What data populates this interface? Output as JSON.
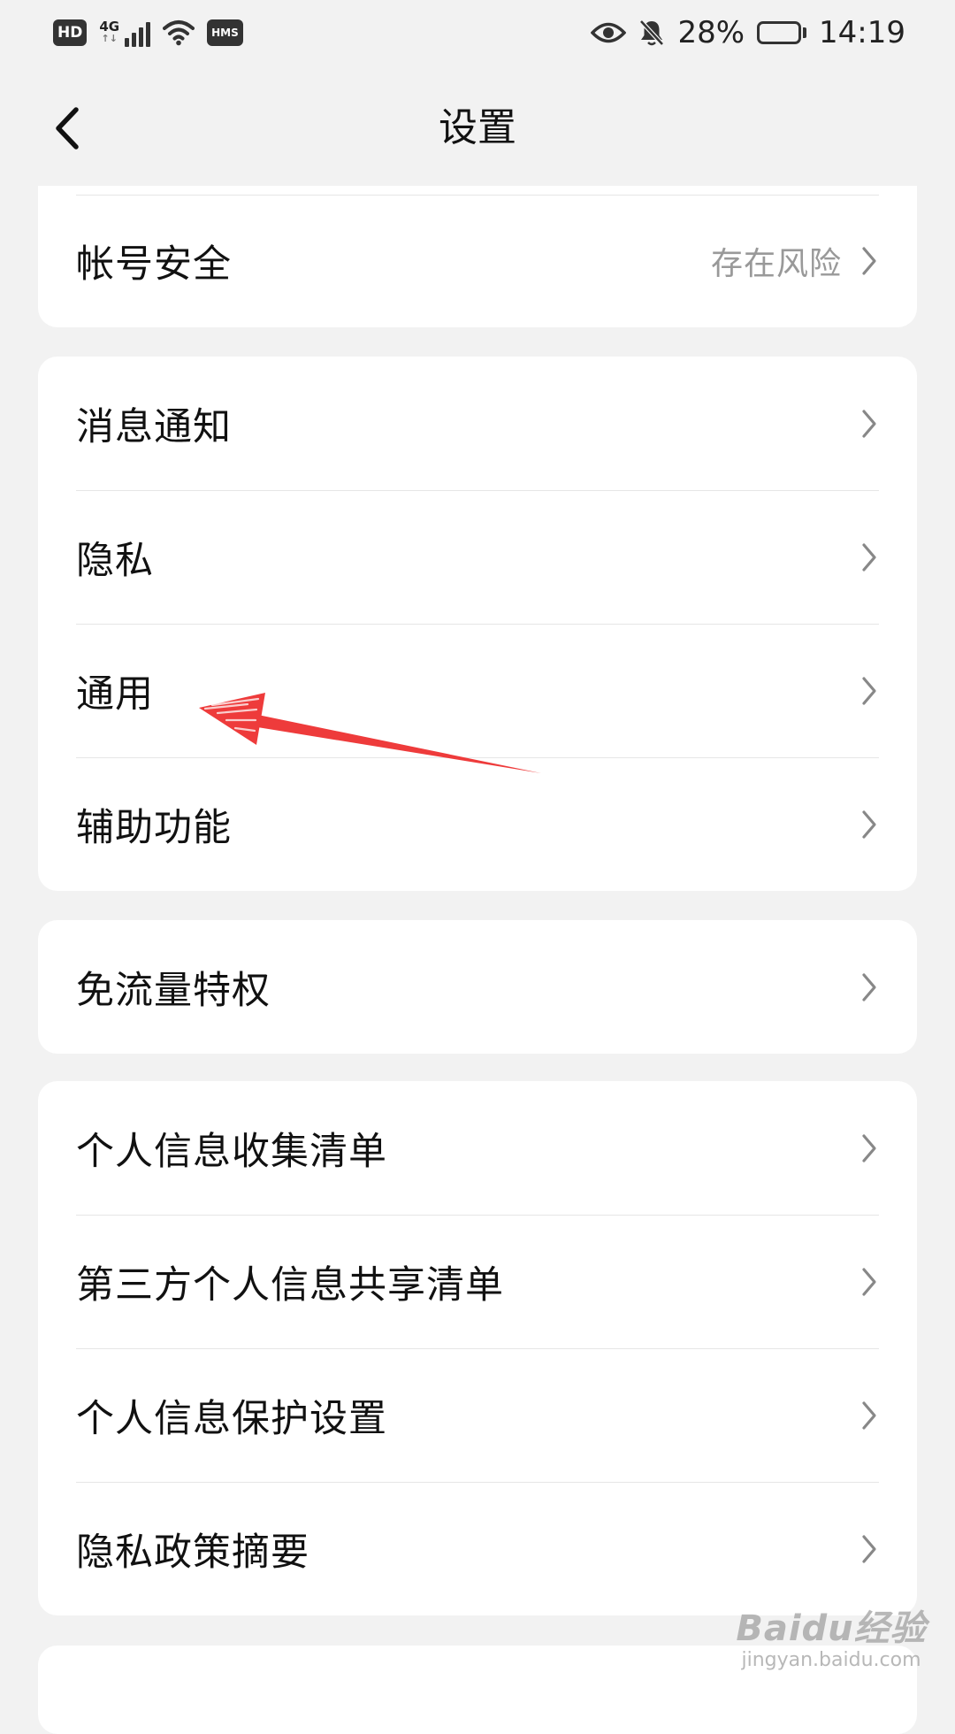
{
  "status_bar": {
    "hd": "HD",
    "network": "4G",
    "network_arrows": "↑↓",
    "hms": "HMS",
    "battery_percent": "28%",
    "battery_level": 0.28,
    "time": "14:19",
    "icons": [
      "signal-icon",
      "wifi-icon",
      "eye-icon",
      "bell-off-icon",
      "battery-icon"
    ]
  },
  "nav": {
    "title": "设置",
    "back_icon": "chevron-left-icon"
  },
  "groups": {
    "account": {
      "security_label": "帐号安全",
      "security_value": "存在风险"
    },
    "general": {
      "notifications": "消息通知",
      "privacy": "隐私",
      "general": "通用",
      "accessibility": "辅助功能"
    },
    "data": {
      "free_traffic": "免流量特权"
    },
    "personal_info": {
      "collection_list": "个人信息收集清单",
      "third_party_list": "第三方个人信息共享清单",
      "protection_settings": "个人信息保护设置",
      "privacy_summary": "隐私政策摘要"
    }
  },
  "annotation": {
    "color": "#ee3b3b",
    "target": "通用"
  },
  "watermark": {
    "main": "Baidu经验",
    "sub": "jingyan.baidu.com"
  }
}
